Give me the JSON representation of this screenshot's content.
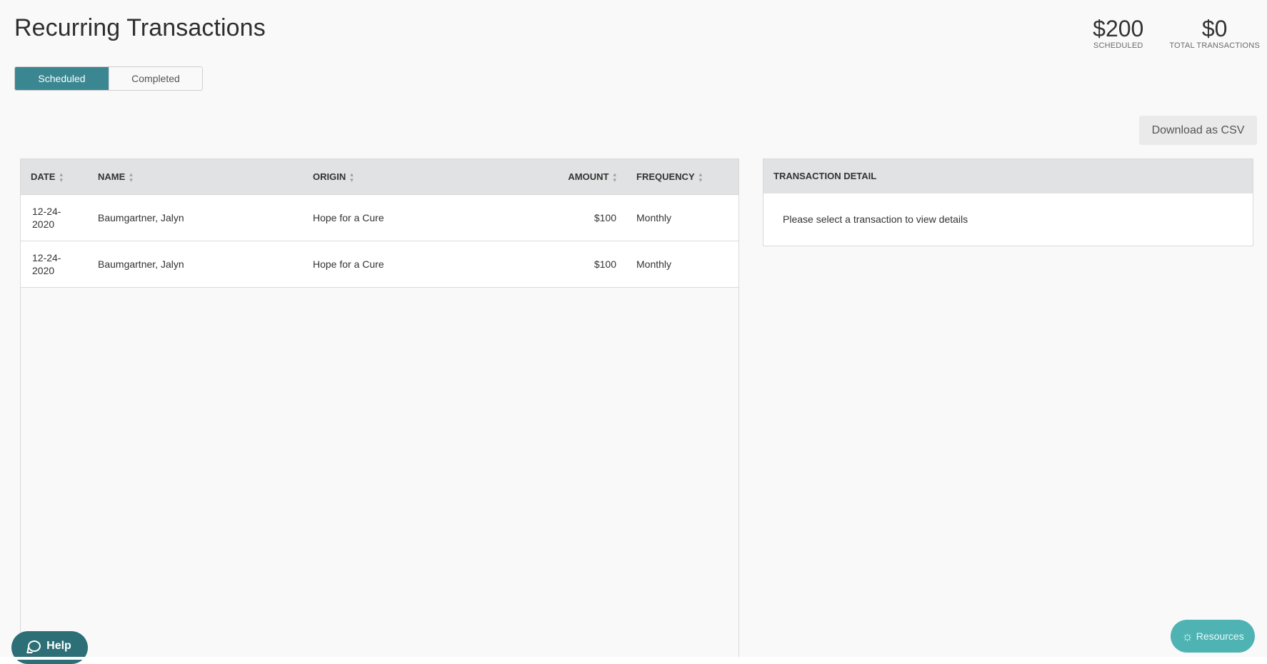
{
  "header": {
    "title": "Recurring Transactions",
    "stats": [
      {
        "value": "$200",
        "label": "SCHEDULED"
      },
      {
        "value": "$0",
        "label": "TOTAL TRANSACTIONS"
      }
    ]
  },
  "tabs": [
    {
      "label": "Scheduled",
      "active": true
    },
    {
      "label": "Completed",
      "active": false
    }
  ],
  "actions": {
    "download_csv_label": "Download as CSV"
  },
  "table": {
    "columns": {
      "date": "DATE",
      "name": "NAME",
      "origin": "ORIGIN",
      "amount": "AMOUNT",
      "frequency": "FREQUENCY"
    },
    "rows": [
      {
        "date": "12-24-\n2020",
        "name": "Baumgartner, Jalyn",
        "origin": "Hope for a Cure",
        "amount": "$100",
        "frequency": "Monthly"
      },
      {
        "date": "12-24-\n2020",
        "name": "Baumgartner, Jalyn",
        "origin": "Hope for a Cure",
        "amount": "$100",
        "frequency": "Monthly"
      }
    ]
  },
  "detail": {
    "title": "TRANSACTION DETAIL",
    "empty_message": "Please select a transaction to view details"
  },
  "help": {
    "label": "Help",
    "icon": "chat-bubble-icon"
  },
  "resources": {
    "label": "Resources",
    "icon": "lightbulb-icon"
  },
  "colors": {
    "accent": "#3a8792",
    "help_bg": "#2d6f76",
    "resources_bg": "#4fb3b3"
  }
}
